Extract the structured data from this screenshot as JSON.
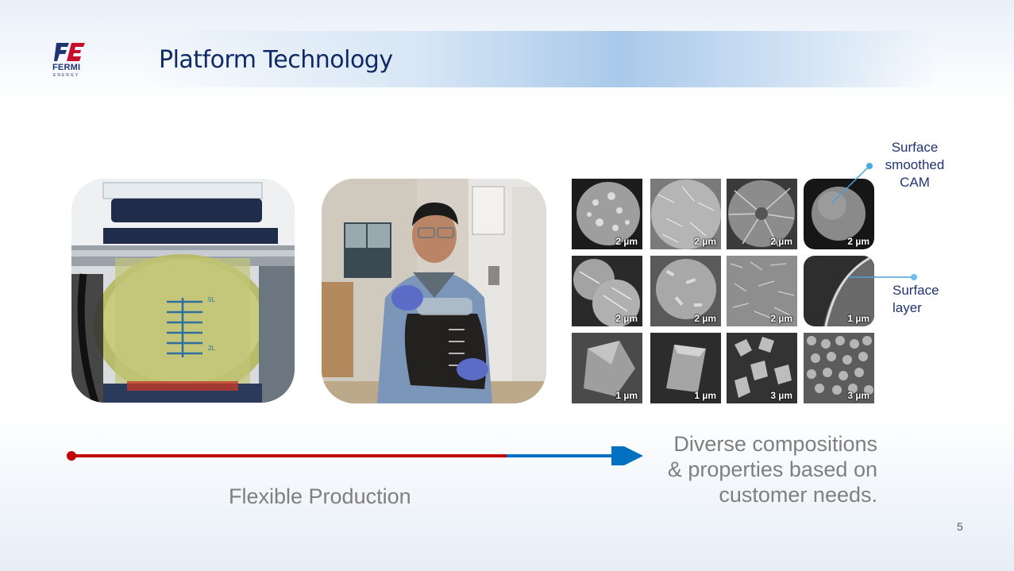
{
  "slide": {
    "title": "Platform Technology",
    "page_number": "5"
  },
  "logo": {
    "wordmark": "FERMI",
    "subtext": "ENERGY",
    "brand_colors": {
      "blue": "#1f3570",
      "red": "#c8102e"
    }
  },
  "photos": {
    "reactor": {
      "icon": "reactor-vessel-image",
      "gradations": [
        "5L",
        "2L"
      ]
    },
    "person": {
      "icon": "scientist-with-flask-image"
    }
  },
  "sem_images": [
    {
      "scale": "2 µm",
      "texture": "spherical-flaky"
    },
    {
      "scale": "2 µm",
      "texture": "spherical-fine"
    },
    {
      "scale": "2 µm",
      "texture": "radial-plates"
    },
    {
      "scale": "2 µm",
      "texture": "smooth-sphere"
    },
    {
      "scale": "2 µm",
      "texture": "coarse-plates"
    },
    {
      "scale": "2 µm",
      "texture": "dense-flakes"
    },
    {
      "scale": "2 µm",
      "texture": "needle-flakes"
    },
    {
      "scale": "1 µm",
      "texture": "surface-layer"
    },
    {
      "scale": "1 µm",
      "texture": "single-crystal"
    },
    {
      "scale": "1 µm",
      "texture": "faceted-crystal"
    },
    {
      "scale": "3 µm",
      "texture": "octahedral-particles"
    },
    {
      "scale": "3 µm",
      "texture": "fine-octahedra"
    }
  ],
  "callouts": {
    "surface_smoothed": [
      "Surface",
      "smoothed",
      "CAM"
    ],
    "surface_layer": [
      "Surface",
      "layer"
    ]
  },
  "arrow": {
    "start_color": "#c00000",
    "end_color": "#0070c0",
    "split_fraction": 0.74
  },
  "labels": {
    "left": "Flexible Production",
    "right": [
      "Diverse compositions",
      "& properties based on",
      "customer needs."
    ]
  }
}
